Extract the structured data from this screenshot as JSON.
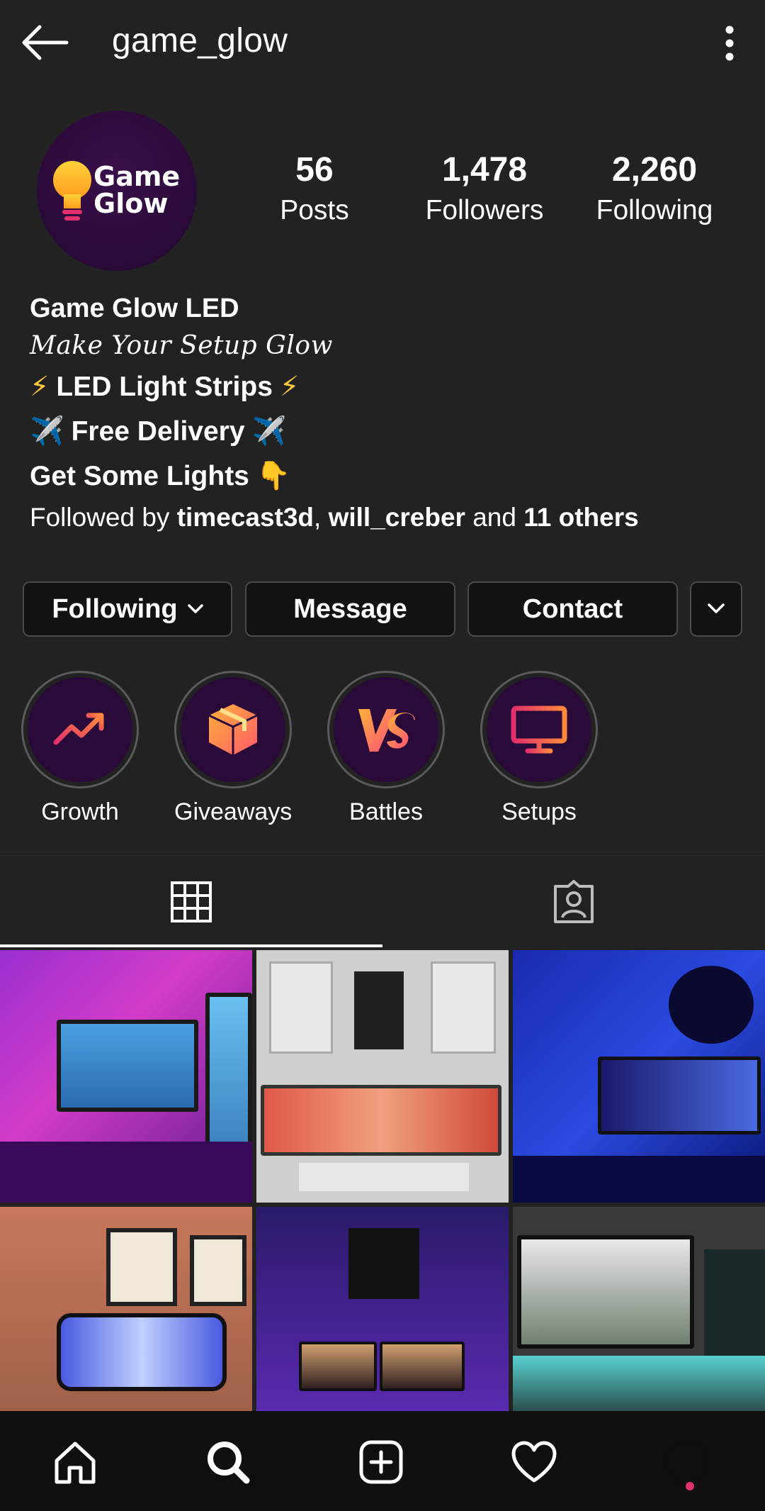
{
  "header": {
    "title": "game_glow"
  },
  "profile": {
    "avatar_text_line1": "Game",
    "avatar_text_line2": "Glow",
    "stats": [
      {
        "value": "56",
        "label": "Posts"
      },
      {
        "value": "1,478",
        "label": "Followers"
      },
      {
        "value": "2,260",
        "label": "Following"
      }
    ],
    "name": "Game Glow LED",
    "tagline": "Make Your Setup Glow",
    "lines": [
      {
        "prefix": "⚡",
        "text": "LED Light Strips",
        "suffix": "⚡"
      },
      {
        "prefix": "✈️",
        "text": "Free Delivery",
        "suffix": "✈️"
      },
      {
        "prefix": "",
        "text": "Get Some Lights",
        "suffix": "👇"
      }
    ],
    "followed_by": {
      "prefix": "Followed by",
      "user1": "timecast3d",
      "sep": ",",
      "user2": "will_creber",
      "mid": "and",
      "others": "11 others"
    }
  },
  "actions": {
    "following": "Following",
    "message": "Message",
    "contact": "Contact"
  },
  "highlights": [
    {
      "label": "Growth",
      "icon": "trend-up-icon"
    },
    {
      "label": "Giveaways",
      "icon": "box-icon"
    },
    {
      "label": "Battles",
      "icon": "vs-icon"
    },
    {
      "label": "Setups",
      "icon": "monitor-icon"
    }
  ],
  "tabs": [
    {
      "name": "grid",
      "icon": "grid-icon",
      "selected": true
    },
    {
      "name": "tagged",
      "icon": "tagged-user-icon",
      "selected": false
    }
  ],
  "colors": {
    "background": "#222222",
    "button_bg": "#121212",
    "highlight_bg": "#2a0a38",
    "accent_pink": "#e1306c",
    "accent_orange": "#ff8a3d"
  }
}
